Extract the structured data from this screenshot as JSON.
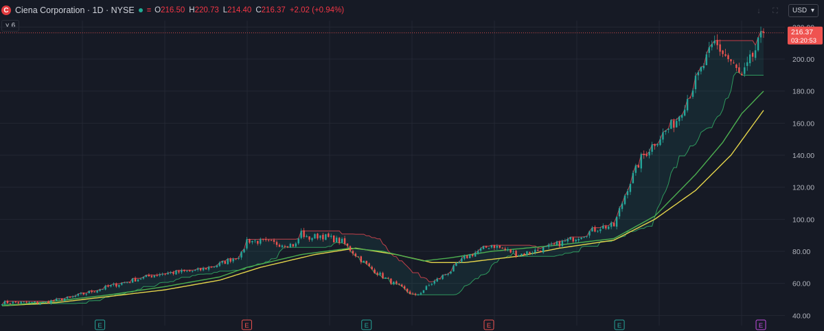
{
  "header": {
    "logo_letter": "C",
    "symbol": "Ciena Corporation · 1D · NYSE",
    "open_label": "O",
    "open_value": "216.50",
    "high_label": "H",
    "high_value": "220.73",
    "low_label": "L",
    "low_value": "214.40",
    "close_label": "C",
    "close_value": "216.37",
    "change": "+2.02 (+0.94%)",
    "lines_icon": "≡"
  },
  "indicator_toggle": {
    "chevron": "˅",
    "count": "6"
  },
  "toolbar": {
    "download_icon": "↓",
    "fullscreen_icon": "⛶"
  },
  "currency": {
    "label": "USD",
    "chevron": "▾"
  },
  "colors": {
    "background": "#161a25",
    "up": "#26a69a",
    "down": "#ef5350",
    "ma_green": "#4caf50",
    "ma_yellow": "#e5d54b",
    "grid": "#232733",
    "axis_text": "#b2b5be"
  },
  "price_label": {
    "value": "216.37",
    "countdown": "03:20:53"
  },
  "earnings_markers": [
    {
      "letter": "E",
      "color": "#26a69a",
      "index": 36
    },
    {
      "letter": "E",
      "color": "#ef5350",
      "index": 90
    },
    {
      "letter": "E",
      "color": "#26a69a",
      "index": 134
    },
    {
      "letter": "E",
      "color": "#ef5350",
      "index": 179
    },
    {
      "letter": "E",
      "color": "#26a69a",
      "index": 227
    },
    {
      "letter": "E",
      "color": "#c34ee0",
      "index": 279
    }
  ],
  "chart_data": {
    "type": "candlestick",
    "ylim": [
      38,
      224
    ],
    "y_ticks": [
      "220.00",
      "200.00",
      "180.00",
      "160.00",
      "140.00",
      "120.00",
      "100.00",
      "80.00",
      "60.00",
      "40.00"
    ],
    "last_price": 216.37,
    "series": [
      {
        "name": "",
        "type": "candles",
        "anchors": [
          [
            0,
            48
          ],
          [
            15,
            48
          ],
          [
            25,
            51
          ],
          [
            35,
            56
          ],
          [
            48,
            62
          ],
          [
            58,
            66
          ],
          [
            72,
            68
          ],
          [
            80,
            72
          ],
          [
            88,
            78
          ],
          [
            90,
            87
          ],
          [
            100,
            85
          ],
          [
            108,
            84
          ],
          [
            110,
            92
          ],
          [
            112,
            88
          ],
          [
            117,
            90
          ],
          [
            125,
            86
          ],
          [
            130,
            78
          ],
          [
            135,
            70
          ],
          [
            142,
            62
          ],
          [
            148,
            56
          ],
          [
            152,
            52
          ],
          [
            158,
            60
          ],
          [
            165,
            68
          ],
          [
            170,
            76
          ],
          [
            180,
            84
          ],
          [
            190,
            78
          ],
          [
            200,
            82
          ],
          [
            210,
            88
          ],
          [
            220,
            95
          ],
          [
            225,
            96
          ],
          [
            230,
            120
          ],
          [
            235,
            138
          ],
          [
            240,
            148
          ],
          [
            248,
            162
          ],
          [
            255,
            186
          ],
          [
            262,
            210
          ],
          [
            268,
            198
          ],
          [
            272,
            188
          ],
          [
            276,
            202
          ],
          [
            280,
            216.37
          ]
        ]
      },
      {
        "name": "",
        "type": "line",
        "color": "#4caf50",
        "anchors": [
          [
            0,
            46
          ],
          [
            20,
            49
          ],
          [
            40,
            53
          ],
          [
            60,
            58
          ],
          [
            80,
            64
          ],
          [
            90,
            70
          ],
          [
            110,
            78
          ],
          [
            128,
            82
          ],
          [
            140,
            80
          ],
          [
            155,
            74
          ],
          [
            165,
            76
          ],
          [
            180,
            80
          ],
          [
            205,
            84
          ],
          [
            225,
            88
          ],
          [
            240,
            102
          ],
          [
            255,
            128
          ],
          [
            265,
            148
          ],
          [
            272,
            166
          ],
          [
            280,
            180
          ]
        ]
      },
      {
        "name": "",
        "type": "line",
        "color": "#e5d54b",
        "anchors": [
          [
            0,
            46
          ],
          [
            20,
            48
          ],
          [
            40,
            52
          ],
          [
            60,
            56
          ],
          [
            80,
            62
          ],
          [
            95,
            70
          ],
          [
            115,
            78
          ],
          [
            130,
            82
          ],
          [
            145,
            78
          ],
          [
            158,
            73
          ],
          [
            170,
            73
          ],
          [
            190,
            77
          ],
          [
            205,
            82
          ],
          [
            225,
            87
          ],
          [
            240,
            100
          ],
          [
            255,
            118
          ],
          [
            268,
            140
          ],
          [
            280,
            168
          ]
        ]
      }
    ]
  }
}
